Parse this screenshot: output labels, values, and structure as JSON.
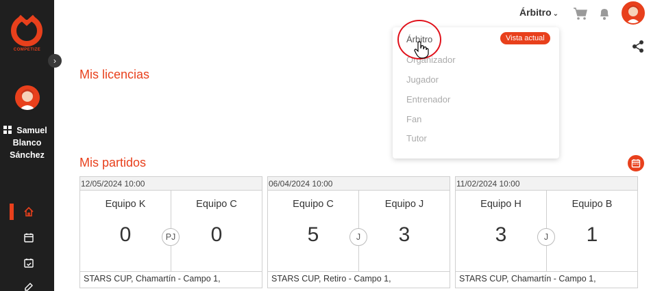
{
  "brand": {
    "logo_text": "COMPETIZE",
    "accent": "#e8401c",
    "sidebar_bg": "#1f1f1f"
  },
  "sidebar": {
    "user_name_line1": "Samuel",
    "user_name_line2": "Blanco",
    "user_name_line3": "Sánchez",
    "nav": [
      "home-icon",
      "calendar-icon",
      "calendar-check-icon",
      "edit-icon"
    ]
  },
  "topbar": {
    "role_label": "Árbitro"
  },
  "sections": {
    "licenses_title": "Mis licencias",
    "matches_title": "Mis partidos"
  },
  "dropdown": {
    "current_badge": "Vista actual",
    "items": [
      "Árbitro",
      "Organizador",
      "Jugador",
      "Entrenador",
      "Fan",
      "Tutor"
    ]
  },
  "matches": [
    {
      "date": "12/05/2024 10:00",
      "home": "Equipo K",
      "away": "Equipo C",
      "home_score": "0",
      "away_score": "0",
      "status": "PJ",
      "venue": "STARS CUP, Chamartín - Campo 1,"
    },
    {
      "date": "06/04/2024 10:00",
      "home": "Equipo C",
      "away": "Equipo J",
      "home_score": "5",
      "away_score": "3",
      "status": "J",
      "venue": "STARS CUP, Retiro - Campo 1,"
    },
    {
      "date": "11/02/2024 10:00",
      "home": "Equipo H",
      "away": "Equipo B",
      "home_score": "3",
      "away_score": "1",
      "status": "J",
      "venue": "STARS CUP, Chamartín - Campo 1,"
    }
  ]
}
